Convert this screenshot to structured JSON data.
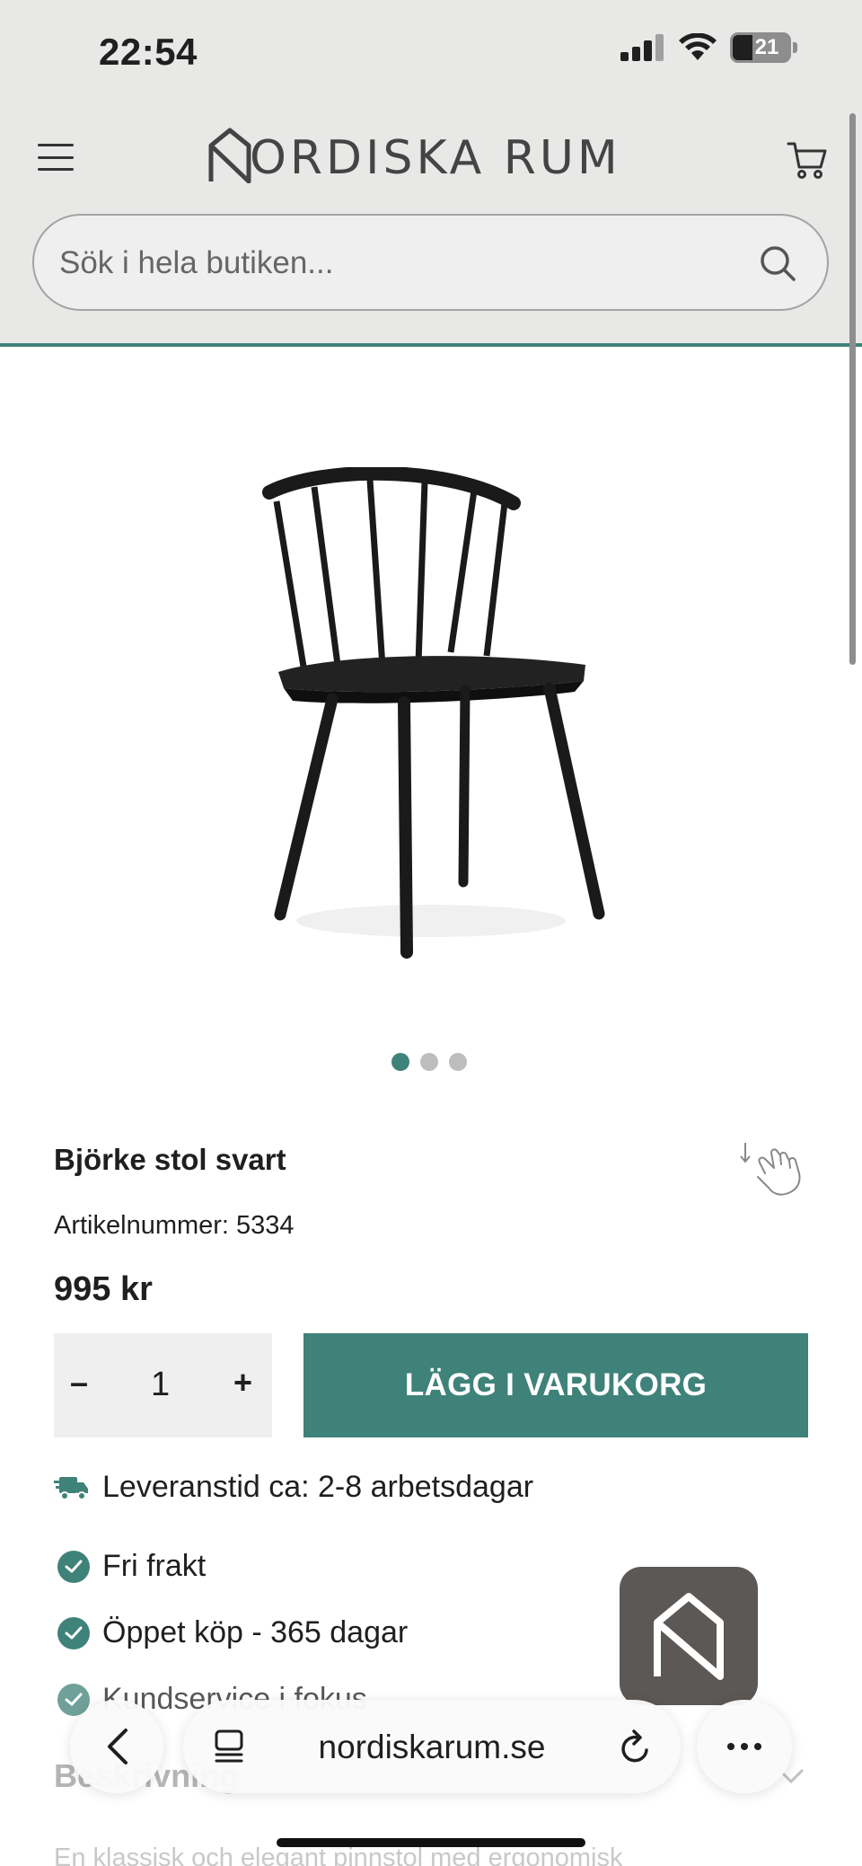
{
  "status_bar": {
    "time": "22:54",
    "battery": "21"
  },
  "header": {
    "logo_text": "ORDISKA RUM",
    "search_placeholder": "Sök i hela butiken..."
  },
  "gallery": {
    "image_count": 3,
    "active_index": 0
  },
  "product": {
    "name": "Björke stol svart",
    "sku_label": "Artikelnummer: 5334",
    "price": "995 kr",
    "quantity": "1",
    "minus_label": "–",
    "plus_label": "+",
    "add_to_cart": "LÄGG I VARUKORG"
  },
  "delivery": {
    "text": "Leveranstid ca: 2-8 arbetsdagar"
  },
  "usps": [
    "Fri frakt",
    "Öppet köp - 365 dagar",
    "Kundservice i fokus"
  ],
  "description": {
    "heading": "Beskrivning",
    "text": "En klassisk och elegant pinnstol med ergonomisk"
  },
  "browser": {
    "url": "nordiskarum.se"
  },
  "colors": {
    "accent": "#3f8279",
    "header_bg": "#e8e8e7"
  }
}
